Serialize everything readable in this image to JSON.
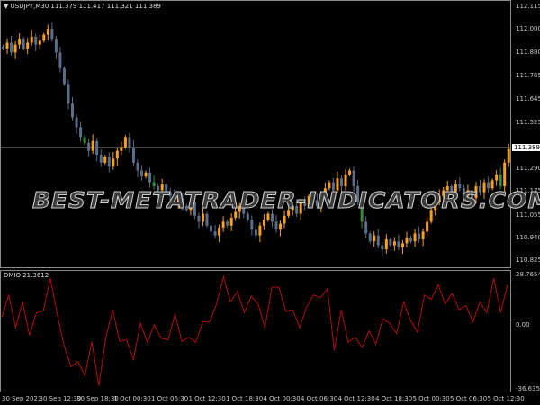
{
  "chart": {
    "symbol": "USDJPY,M30",
    "ohlc_readout": "111.379 111.417 111.321 111.389",
    "current_price": "111.389",
    "watermark": "BEST-METATRADER-INDICATORS.COM",
    "colors": {
      "background": "#000000",
      "bull": "#f5a01e",
      "bear": "#5a6e88",
      "grid": "#8a8a8a",
      "indicator": "#b01010"
    },
    "price_axis": [
      "112.115",
      "112.000",
      "111.880",
      "111.765",
      "111.645",
      "111.525",
      "111.290",
      "111.175",
      "111.055",
      "110.940",
      "110.825"
    ],
    "time_axis": [
      "30 Sep 2021",
      "30 Sep 12:30",
      "30 Sep 18:30",
      "1 Oct 00:30",
      "1 Oct 06:30",
      "1 Oct 12:30",
      "1 Oct 18:30",
      "4 Oct 00:30",
      "4 Oct 06:30",
      "4 Oct 12:30",
      "4 Oct 18:30",
      "5 Oct 00:30",
      "5 Oct 06:30",
      "5 Oct 12:30"
    ]
  },
  "indicator": {
    "title": "DMIO 21.3612",
    "axis": [
      "28.7654",
      "0.00",
      "-36.6358"
    ]
  },
  "chart_data": [
    {
      "type": "candlestick",
      "ylim": [
        110.825,
        112.115
      ],
      "close": [
        111.9,
        111.93,
        111.88,
        111.92,
        111.95,
        111.9,
        111.93,
        111.96,
        111.92,
        111.94,
        111.97,
        112.0,
        111.95,
        111.88,
        111.8,
        111.72,
        111.62,
        111.55,
        111.5,
        111.45,
        111.42,
        111.38,
        111.43,
        111.36,
        111.32,
        111.35,
        111.3,
        111.34,
        111.38,
        111.4,
        111.45,
        111.4,
        111.32,
        111.28,
        111.25,
        111.27,
        111.22,
        111.2,
        111.18,
        111.21,
        111.17,
        111.15,
        111.12,
        111.14,
        111.1,
        111.08,
        111.12,
        111.05,
        111.02,
        111.06,
        111.0,
        110.97,
        110.95,
        110.99,
        111.02,
        111.0,
        111.04,
        111.07,
        111.1,
        111.06,
        111.03,
        110.98,
        110.95,
        111.0,
        111.03,
        111.06,
        111.02,
        110.98,
        111.01,
        111.05,
        111.08,
        111.1,
        111.06,
        111.12,
        111.1,
        111.15,
        111.13,
        111.1,
        111.16,
        111.19,
        111.22,
        111.18,
        111.24,
        111.2,
        111.26,
        111.28,
        111.2,
        111.12,
        111.02,
        110.96,
        110.92,
        110.95,
        110.9,
        110.88,
        110.93,
        110.9,
        110.92,
        110.89,
        110.91,
        110.94,
        110.92,
        110.96,
        110.93,
        110.97,
        111.02,
        111.08,
        111.12,
        111.15,
        111.18,
        111.2,
        111.17,
        111.21,
        111.19,
        111.15,
        111.18,
        111.14,
        111.2,
        111.17,
        111.22,
        111.19,
        111.23,
        111.26,
        111.2,
        111.32,
        111.389
      ]
    },
    {
      "type": "line",
      "name": "DMIO",
      "ylim": [
        -36.6358,
        28.7654
      ],
      "values": [
        4.3,
        17,
        -1.7,
        13,
        -6,
        7,
        8,
        26.7,
        6,
        -12,
        -24,
        -21,
        -29,
        -9.5,
        -35,
        -7.7,
        8.6,
        -9.5,
        -8.6,
        -19.8,
        0.9,
        -10,
        0,
        -7.7,
        -8.6,
        6,
        -9.5,
        -7,
        -10,
        1.7,
        1.7,
        12,
        27.5,
        13,
        19,
        7,
        16.3,
        12,
        -1.7,
        21.5,
        21.5,
        7.7,
        8.6,
        -1.7,
        10.3,
        17,
        15.5,
        20.6,
        -14.6,
        8.6,
        -10,
        -7,
        -13,
        -3.4,
        -11,
        3.4,
        0.9,
        -5,
        13,
        2.6,
        -4.3,
        17,
        14.6,
        23,
        12,
        18,
        8.6,
        11,
        1.7,
        13,
        7,
        26.7,
        7,
        23
      ]
    }
  ]
}
